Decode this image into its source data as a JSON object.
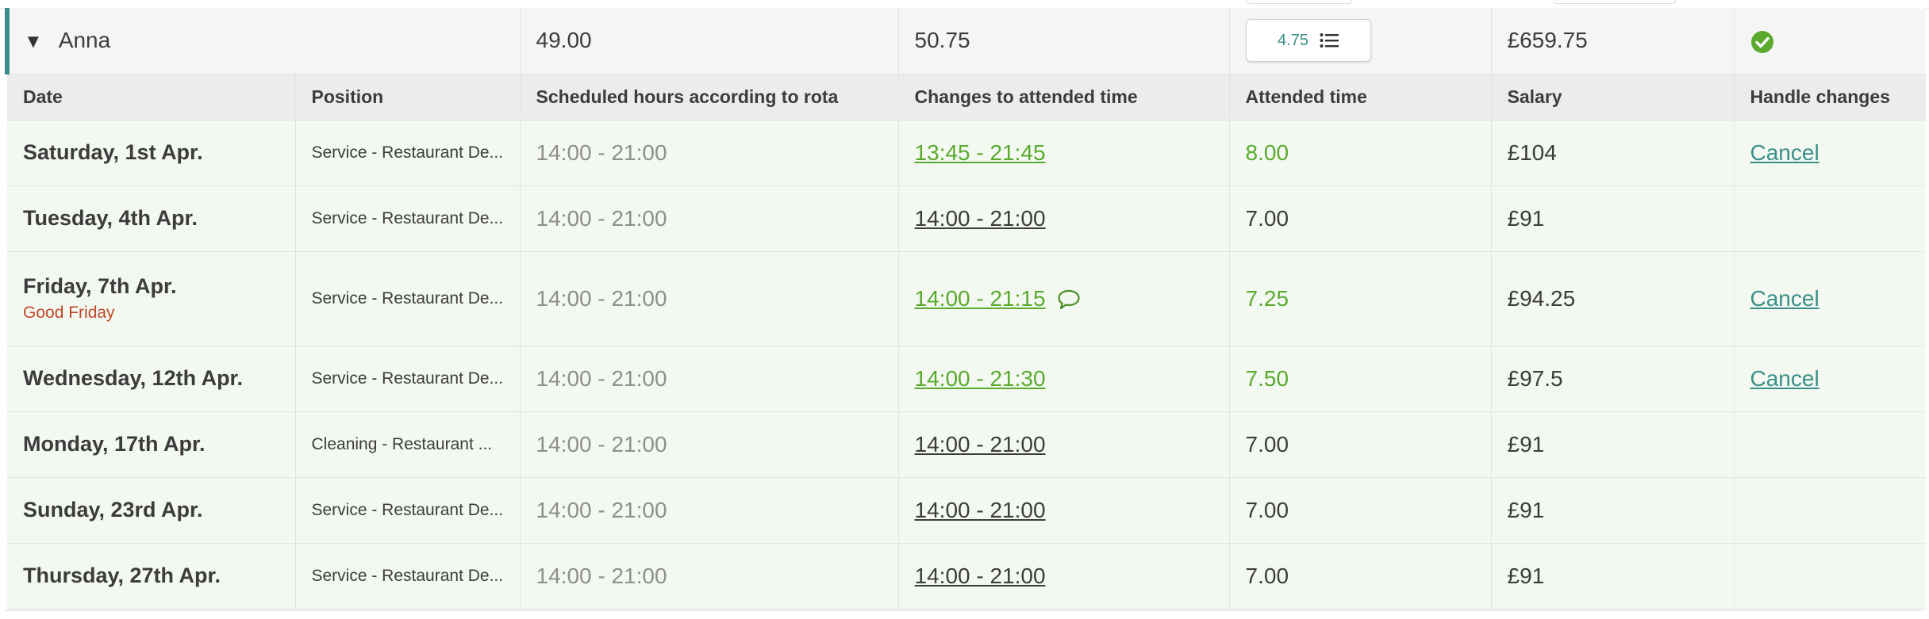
{
  "summary": {
    "name": "Anna",
    "scheduled_total": "49.00",
    "changes_total": "50.75",
    "attended_badge": "4.75",
    "salary_total": "£659.75"
  },
  "columns": [
    "Date",
    "Position",
    "Scheduled hours according to rota",
    "Changes to attended time",
    "Attended time",
    "Salary",
    "Handle changes"
  ],
  "rows": [
    {
      "date": "Saturday, 1st Apr.",
      "holiday": "",
      "position": "Service - Restaurant De...",
      "scheduled": "14:00 - 21:00",
      "changed_time": "13:45 - 21:45",
      "attended": "8.00",
      "salary": "£104",
      "action": "Cancel"
    },
    {
      "date": "Tuesday, 4th Apr.",
      "holiday": "",
      "position": "Service - Restaurant De...",
      "scheduled": "14:00 - 21:00",
      "changed_time": "14:00 - 21:00",
      "attended": "7.00",
      "salary": "£91",
      "action": ""
    },
    {
      "date": "Friday, 7th Apr.",
      "holiday": "Good Friday",
      "position": "Service - Restaurant De...",
      "scheduled": "14:00 - 21:00",
      "changed_time": "14:00 - 21:15",
      "attended": "7.25",
      "salary": "£94.25",
      "action": "Cancel"
    },
    {
      "date": "Wednesday, 12th Apr.",
      "holiday": "",
      "position": "Service - Restaurant De...",
      "scheduled": "14:00 - 21:00",
      "changed_time": "14:00 - 21:30",
      "attended": "7.50",
      "salary": "£97.5",
      "action": "Cancel"
    },
    {
      "date": "Monday, 17th Apr.",
      "holiday": "",
      "position": "Cleaning - Restaurant ...",
      "scheduled": "14:00 - 21:00",
      "changed_time": "14:00 - 21:00",
      "attended": "7.00",
      "salary": "£91",
      "action": ""
    },
    {
      "date": "Sunday, 23rd Apr.",
      "holiday": "",
      "position": "Service - Restaurant De...",
      "scheduled": "14:00 - 21:00",
      "changed_time": "14:00 - 21:00",
      "attended": "7.00",
      "salary": "£91",
      "action": ""
    },
    {
      "date": "Thursday, 27th Apr.",
      "holiday": "",
      "position": "Service - Restaurant De...",
      "scheduled": "14:00 - 21:00",
      "changed_time": "14:00 - 21:00",
      "attended": "7.00",
      "salary": "£91",
      "action": ""
    }
  ],
  "icons": {
    "collapse": "caret-down-icon",
    "list": "list-icon",
    "approved": "check-circle-icon",
    "comment": "comment-icon"
  },
  "colors": {
    "accent_teal": "#3a8f8a",
    "changed_green": "#5aaa2e",
    "holiday_red": "#c0472b",
    "row_bg": "#f3f9f1"
  }
}
